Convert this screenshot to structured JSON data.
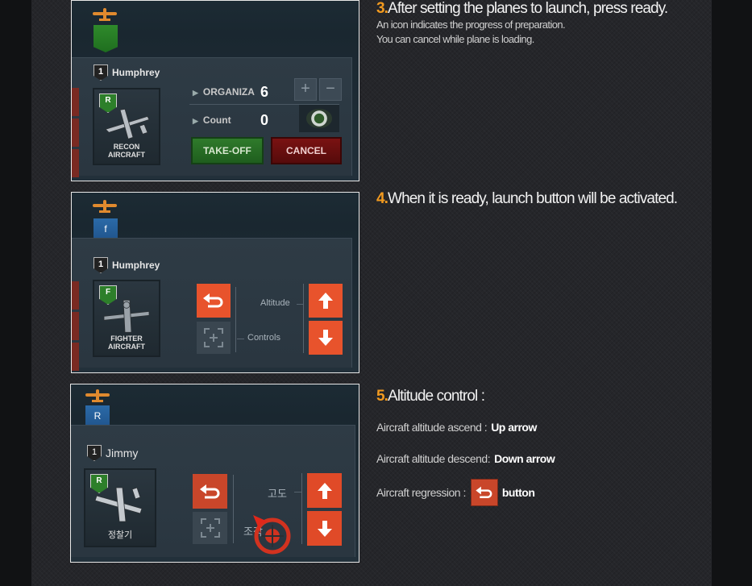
{
  "colors": {
    "accent_orange": "#f29a1f",
    "button_orange": "#e8532c",
    "takeoff_green": "#2f7a2b",
    "cancel_red": "#7a1212"
  },
  "steps": [
    {
      "number": "3.",
      "title": "After setting the planes to launch, press ready.",
      "notes": [
        "An icon indicates the progress of preparation.",
        "You can cancel while plane is loading."
      ]
    },
    {
      "number": "4.",
      "title": "When it is ready, launch button will be activated."
    },
    {
      "number": "5.",
      "title": "Altitude control :",
      "lines": [
        {
          "prefix": "Aircraft altitude ascend : ",
          "bold": "Up arrow"
        },
        {
          "prefix": "Aircraft altitude descend: ",
          "bold": "Down arrow"
        },
        {
          "prefix": "Aircraft regression : ",
          "icon": "regression-arrow-icon",
          "bold": "button"
        }
      ]
    }
  ],
  "screens": [
    {
      "flag_letter": "",
      "flag_color": "green",
      "pilot_rank": "1",
      "pilot_name": "Humphrey",
      "aircraft_badge": "R",
      "aircraft_type": "RECON AIRCRAFT",
      "organize_label": "ORGANIZA",
      "organize_value": "6",
      "count_label": "Count",
      "count_value": "0",
      "plus_label": "+",
      "minus_label": "−",
      "takeoff_label": "TAKE-OFF",
      "cancel_label": "CANCEL"
    },
    {
      "flag_letter": "f",
      "flag_color": "blue",
      "pilot_rank": "1",
      "pilot_name": "Humphrey",
      "aircraft_badge": "F",
      "aircraft_type": "FIGHTER AIRCRAFT",
      "altitude_label": "Altitude",
      "controls_label": "Controls"
    },
    {
      "flag_letter": "R",
      "flag_color": "blue",
      "pilot_rank": "1",
      "pilot_name": "Jimmy",
      "aircraft_badge": "R",
      "aircraft_type": "정찰기",
      "altitude_label": "고도",
      "controls_label": "조작"
    }
  ]
}
